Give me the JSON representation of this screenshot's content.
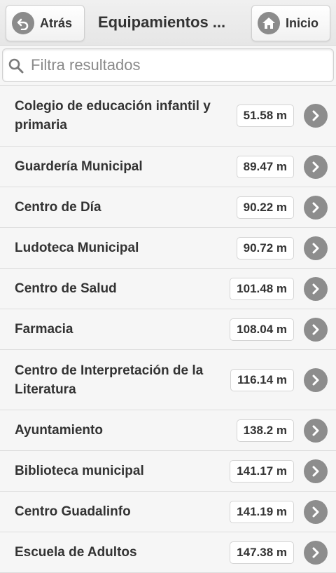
{
  "header": {
    "back_label": "Atrás",
    "title": "Equipamientos ...",
    "home_label": "Inicio"
  },
  "search": {
    "placeholder": "Filtra resultados",
    "value": ""
  },
  "items": [
    {
      "name": "Colegio de educación infantil y primaria",
      "distance": "51.58 m"
    },
    {
      "name": "Guardería Municipal",
      "distance": "89.47 m"
    },
    {
      "name": "Centro de Día",
      "distance": "90.22 m"
    },
    {
      "name": "Ludoteca Municipal",
      "distance": "90.72 m"
    },
    {
      "name": "Centro de Salud",
      "distance": "101.48 m"
    },
    {
      "name": "Farmacia",
      "distance": "108.04 m"
    },
    {
      "name": "Centro de Interpretación de la Literatura",
      "distance": "116.14 m"
    },
    {
      "name": "Ayuntamiento",
      "distance": "138.2 m"
    },
    {
      "name": "Biblioteca municipal",
      "distance": "141.17 m"
    },
    {
      "name": "Centro Guadalinfo",
      "distance": "141.19 m"
    },
    {
      "name": "Escuela de Adultos",
      "distance": "147.38 m"
    }
  ],
  "icons": {
    "back": "undo-arrow-icon",
    "home": "house-icon",
    "search": "search-icon",
    "row": "chevron-right-icon"
  }
}
